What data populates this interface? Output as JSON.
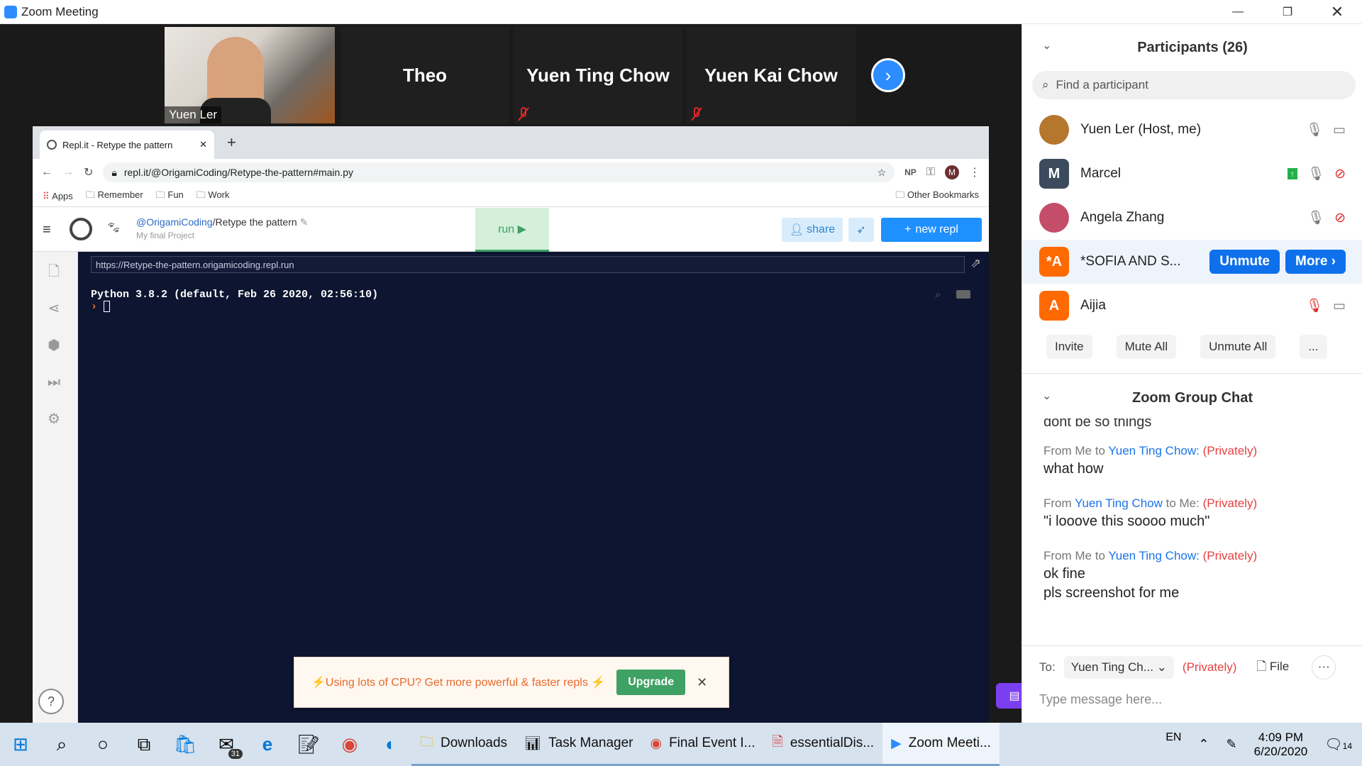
{
  "window": {
    "title": "Zoom Meeting"
  },
  "video_strip": {
    "self": {
      "name": "Yuen Ler"
    },
    "tiles": [
      {
        "name": "Theo"
      },
      {
        "name": "Yuen Ting Chow"
      },
      {
        "name": "Yuen Kai Chow"
      }
    ]
  },
  "browser": {
    "tab_title": "Repl.it - Retype the pattern",
    "url": "repl.it/@OrigamiCoding/Retype-the-pattern#main.py",
    "profile_initials": "NP",
    "profile_letter": "M",
    "bookmarks": [
      {
        "label": "Apps"
      },
      {
        "label": "Remember"
      },
      {
        "label": "Fun"
      },
      {
        "label": "Work"
      }
    ],
    "other_bookmarks": "Other Bookmarks"
  },
  "repl": {
    "user": "@OrigamiCoding",
    "sep": "/",
    "project": "Retype the pattern",
    "subtitle": "My final Project",
    "run_label": "run ▶",
    "share_label": "share",
    "new_repl_label": "new repl",
    "console_url": "https://Retype-the-pattern.origamicoding.repl.run",
    "python_banner": "Python 3.8.2 (default, Feb 26 2020, 02:56:10)",
    "prompt": "›",
    "cpu_message": "⚡Using lots of CPU? Get more powerful & faster repls ⚡",
    "upgrade_label": "Upgrade",
    "help_label": "?"
  },
  "participants": {
    "header": "Participants (26)",
    "search_placeholder": "Find a participant",
    "list": [
      {
        "name": "Yuen Ler (Host, me)",
        "avatar": "",
        "color": "#b5762e"
      },
      {
        "name": "Marcel",
        "avatar": "M",
        "color": "#3b4a5c"
      },
      {
        "name": "Angela Zhang",
        "avatar": "",
        "color": "#c44d69"
      },
      {
        "name": "*SOFIA AND S...",
        "avatar": "*A",
        "color": "#ff6a00"
      },
      {
        "name": "Aijia",
        "avatar": "A",
        "color": "#ff6a00"
      }
    ],
    "unmute_label": "Unmute",
    "more_label": "More ›",
    "buttons": {
      "invite": "Invite",
      "mute_all": "Mute All",
      "unmute_all": "Unmute All",
      "more": "..."
    }
  },
  "chat": {
    "header": "Zoom Group Chat",
    "partial": "dont be so things",
    "messages": [
      {
        "from": "Me",
        "to": "Yuen Ting Chow:",
        "priv": "(Privately)",
        "body": [
          "what how"
        ],
        "order": "me-to"
      },
      {
        "from": "Yuen Ting Chow",
        "to": "Me:",
        "priv": "(Privately)",
        "body": [
          "\"i looove this soooo much\""
        ],
        "order": "from-other"
      },
      {
        "from": "Me",
        "to": "Yuen Ting Chow:",
        "priv": "(Privately)",
        "body": [
          "ok fine",
          "pls screenshot for me"
        ],
        "order": "me-to"
      }
    ],
    "to_label": "To:",
    "to_value": "Yuen Ting Ch...",
    "privately": "(Privately)",
    "file_label": "File",
    "placeholder": "Type message here..."
  },
  "taskbar": {
    "apps": [
      {
        "label": "Downloads"
      },
      {
        "label": "Task Manager"
      },
      {
        "label": "Final Event I..."
      },
      {
        "label": "essentialDis..."
      },
      {
        "label": "Zoom Meeti..."
      }
    ],
    "mail_badge": "31",
    "lang": "EN",
    "time": "4:09 PM",
    "date": "6/20/2020",
    "notif_count": "14"
  }
}
